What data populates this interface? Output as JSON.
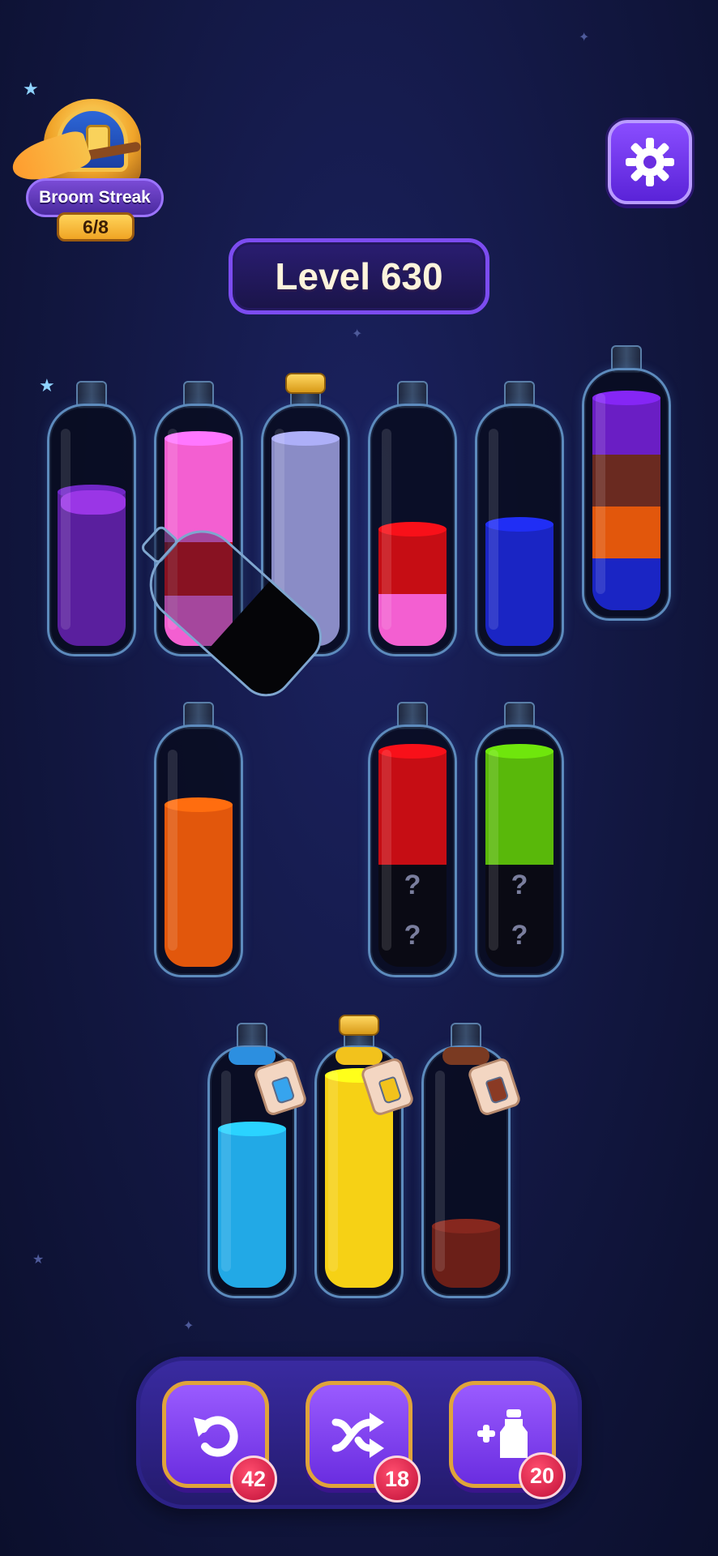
{
  "streak": {
    "title": "Broom Streak",
    "count": "6/8"
  },
  "level": {
    "label": "Level 630"
  },
  "colors": {
    "purple": "#5a1f9e",
    "pink": "#f35fd1",
    "red": "#c60d14",
    "lavender": "#8a8cc6",
    "blue": "#1a25c4",
    "brown": "#6a2a20",
    "orange": "#e2570c",
    "green": "#59b80a",
    "cyan": "#22a9e6",
    "yellow": "#f6d115",
    "darkred": "#6b1f18",
    "hidden": "#0a0a14"
  },
  "bottles_row1": [
    {
      "name": "bottle-1",
      "layers": [
        "purple"
      ],
      "cork": false
    },
    {
      "name": "bottle-2",
      "layers": [
        "pink",
        "red",
        "pink"
      ],
      "cork": false
    },
    {
      "name": "bottle-3",
      "layers": [
        "lavender",
        "lavender",
        "lavender",
        "lavender"
      ],
      "cork": true
    },
    {
      "name": "bottle-4",
      "layers": [
        "pink",
        "red"
      ],
      "cork": false
    },
    {
      "name": "bottle-5",
      "layers": [
        "blue",
        "blue"
      ],
      "cork": false
    },
    {
      "name": "bottle-6",
      "layers": [
        "blue",
        "orange",
        "brown",
        "purple"
      ],
      "cork": false
    }
  ],
  "bottles_row2": [
    {
      "name": "bottle-7",
      "layers": [
        "orange",
        "orange",
        "orange"
      ]
    },
    {
      "name": "bottle-8",
      "layers": [
        "hidden",
        "hidden",
        "red"
      ],
      "question_marks": [
        "?",
        "?"
      ]
    },
    {
      "name": "bottle-9",
      "layers": [
        "hidden",
        "hidden",
        "green"
      ],
      "question_marks": [
        "?",
        "?"
      ]
    }
  ],
  "bottles_row3": [
    {
      "name": "bottle-cyan",
      "liquid": "cyan",
      "fill": 0.62,
      "rope": "#2c8fe0",
      "locked": true
    },
    {
      "name": "bottle-yellow",
      "liquid": "yellow",
      "fill": 0.9,
      "rope": "#f2c21c",
      "locked": true,
      "cork": true
    },
    {
      "name": "bottle-brown",
      "liquid": "darkred",
      "fill": 0.28,
      "rope": "#7a3a22",
      "locked": true
    }
  ],
  "tools": {
    "undo": {
      "count": "42"
    },
    "shuffle": {
      "count": "18"
    },
    "add_bottle": {
      "count": "20"
    }
  }
}
